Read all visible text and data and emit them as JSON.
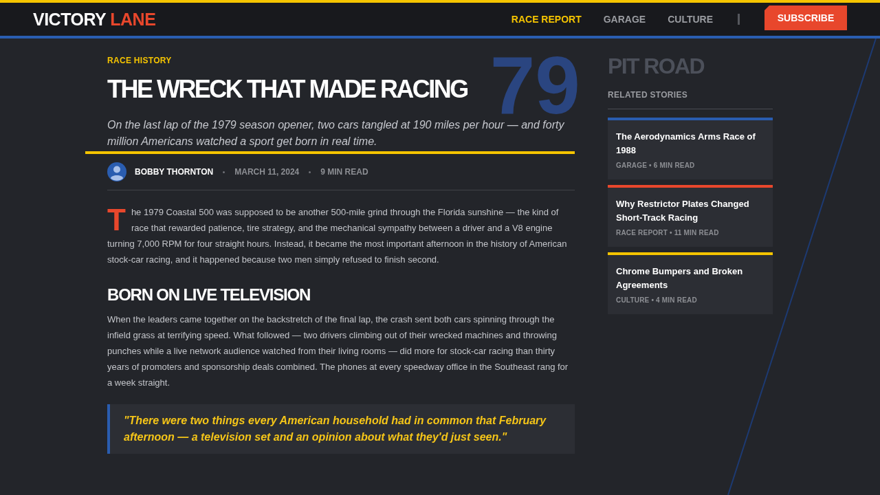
{
  "header": {
    "logo": {
      "text": "VICTORY",
      "accent": "LANE"
    },
    "nav": [
      {
        "label": "RACE REPORT",
        "selected": true
      },
      {
        "label": "GARAGE",
        "selected": false
      },
      {
        "label": "CULTURE",
        "selected": false
      }
    ],
    "subscribe_button": "SUBSCRIBE"
  },
  "article": {
    "category": "RACE HISTORY",
    "backdrop_number": "79",
    "title": "THE WRECK THAT MADE RACING",
    "standfirst": "On the last lap of the 1979 season opener, two cars tangled at 190 miles per hour — and forty million Americans watched a sport get born in real time.",
    "byline": {
      "author": "BOBBY THORNTON",
      "date": "MARCH 11, 2024",
      "read_time": "9 MIN READ"
    },
    "body": [
      {
        "kind": "paragraph",
        "drop_cap": true,
        "text": "The 1979 Coastal 500 was supposed to be another 500-mile grind through the Florida sunshine — the kind of race that rewarded patience, tire strategy, and the mechanical sympathy between a driver and a V8 engine turning 7,000 RPM for four straight hours. Instead, it became the most important afternoon in the history of American stock-car racing, and it happened because two men simply refused to finish second."
      },
      {
        "kind": "heading",
        "text": "BORN ON LIVE TELEVISION"
      },
      {
        "kind": "paragraph",
        "drop_cap": false,
        "text": "When the leaders came together on the backstretch of the final lap, the crash sent both cars spinning through the infield grass at terrifying speed. What followed — two drivers climbing out of their wrecked machines and throwing punches while a live network audience watched from their living rooms — did more for stock-car racing than thirty years of promoters and sponsorship deals combined. The phones at every speedway office in the Southeast rang for a week straight."
      },
      {
        "kind": "quote",
        "text": "\"There were two things every American household had in common that February afternoon — a television set and an opinion about what they'd just seen.\""
      }
    ]
  },
  "sidebar": {
    "title": "PIT ROAD",
    "subtitle": "RELATED STORIES",
    "stories": [
      {
        "title": "The Aerodynamics Arms Race of 1988",
        "meta": "GARAGE • 6 MIN READ",
        "color": "#2a5db0"
      },
      {
        "title": "Why Restrictor Plates Changed Short-Track Racing",
        "meta": "RACE REPORT • 11 MIN READ",
        "color": "#e8472c"
      },
      {
        "title": "Chrome Bumpers and Broken Agreements",
        "meta": "CULTURE • 4 MIN READ",
        "color": "#f5c400"
      }
    ]
  }
}
